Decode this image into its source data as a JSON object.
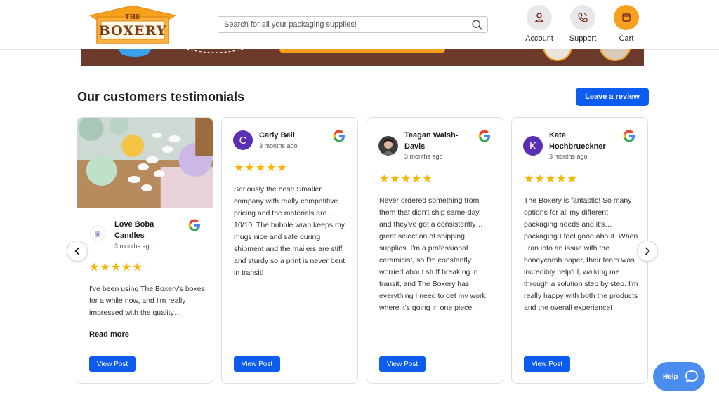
{
  "header": {
    "logo": {
      "the": "THE",
      "main": "BOXERY"
    },
    "search_placeholder": "Search for all your packaging supplies!",
    "nav": [
      {
        "label": "Account",
        "icon": "user-icon"
      },
      {
        "label": "Support",
        "icon": "phone-icon"
      },
      {
        "label": "Cart",
        "icon": "cart-icon"
      }
    ]
  },
  "section": {
    "title": "Our customers testimonials",
    "leave_review": "Leave a review"
  },
  "reviews": [
    {
      "name": "Love Boba Candles",
      "time": "3 months ago",
      "rating": 5,
      "stars": "★★★★★",
      "text": "I've been using The Boxery's boxes for a while now, and I'm really impressed with the quality…",
      "read_more": "Read more",
      "view_post": "View Post"
    },
    {
      "name": "Carly Bell",
      "initial": "C",
      "time": "3 months ago",
      "rating": 5,
      "stars": "★★★★★",
      "text": "Seriously the best! Smaller company with really competitive pricing and the materials are… 10/10. The bubble wrap keeps my mugs nice and safe during shipment and the mailers are stiff and sturdy so a print is never bent in transit!",
      "view_post": "View Post"
    },
    {
      "name": "Teagan Walsh-Davis",
      "time": "3 months ago",
      "rating": 5,
      "stars": "★★★★★",
      "text": "Never ordered something from them that didn't ship same-day, and they've got a consistently… great selection of shipping supplies. I'm a professional ceramicist, so I'm constantly worried about stuff breaking in transit, and The Boxery has everything I need to get my work where it's going in one piece.",
      "view_post": "View Post"
    },
    {
      "name": "Kate Hochbrueckner",
      "initial": "K",
      "time": "3 months ago",
      "rating": 5,
      "stars": "★★★★★",
      "text": "The Boxery is fantastic! So many options for all my different packaging needs and it's… packaging I feel good about. When I ran into an issue with the honeycomb paper, their team was incredibly helpful, walking me through a solution step by step. I'm really happy with both the products and the overall experience!",
      "view_post": "View Post"
    }
  ],
  "help_label": "Help",
  "colors": {
    "primary": "#0d5cf0",
    "accent_orange": "#f7a01e",
    "star": "#f7b500",
    "avatar_purple": "#5a2fb4",
    "banner_brown": "#6b3a2a"
  }
}
